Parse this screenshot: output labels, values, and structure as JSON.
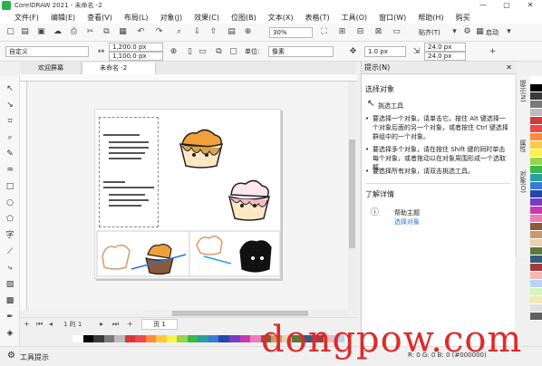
{
  "window": {
    "title": "CorelDRAW 2021 - 未命名 -2",
    "controls": [
      "—",
      "▢",
      "✕"
    ]
  },
  "menus": [
    "文件(F)",
    "编辑(E)",
    "查看(V)",
    "布局(L)",
    "对象(J)",
    "效果(C)",
    "位图(B)",
    "文本(X)",
    "表格(T)",
    "工具(O)",
    "窗口(W)",
    "帮助(H)",
    "购买"
  ],
  "toolbar": {
    "zoom": "30%",
    "snap": "贴齐(T)",
    "launch": "启动"
  },
  "propbar": {
    "preset": "自定义",
    "width": "1,200.0 px",
    "height": "1,100.0 px",
    "units_label": "单位:",
    "units": "像素",
    "nudge": "1.0 px",
    "dup_x": "24.0 px",
    "dup_y": "24.0 px"
  },
  "tabs": [
    {
      "label": "欢迎屏幕"
    },
    {
      "label": "未命名 -2"
    }
  ],
  "pagebar": {
    "page_count": "1 的 1",
    "page_tab": "页 1"
  },
  "docker": {
    "title": "提示(N)",
    "heading": "选择对象",
    "tool": "挑选工具",
    "tips": [
      "要选择一个对象，请单击它。按住 Alt 键选择一个对象后面的另一个对象，或者按住 Ctrl 键选择群组中的一个对象。",
      "要选择多个对象，请在按住 Shift 键的同时单击每个对象，或者拖动以在对象周围形成一个选取框。",
      "要选择所有对象，请双击挑选工具。"
    ],
    "more_heading": "了解详情",
    "help_title": "帮助主题",
    "help_link": "选择对象"
  },
  "side_tabs": [
    "提示(N)",
    "属性",
    "对象(O)"
  ],
  "status": {
    "left": "工具提示",
    "values": "R: 0 G: 0 B: 0 (#000000)"
  },
  "palette": [
    "#ffffff",
    "#000000",
    "#3a3a3a",
    "#7a7a7a",
    "#bcbcbc",
    "#d23a3a",
    "#f04848",
    "#ff8a3a",
    "#ffc840",
    "#fff04a",
    "#9ad44a",
    "#3ab84a",
    "#28a0a0",
    "#3a7ad4",
    "#2448a8",
    "#7a3ac8",
    "#c43ab0",
    "#f07ab8",
    "#8a5a3a",
    "#c89a6a",
    "#e8d2b0",
    "#5a7a3a",
    "#3a5a7a",
    "#a83a3a",
    "#f4b8b8",
    "#b8d4f4",
    "#d4f4b8",
    "#f4e8b8",
    "#e0e0e0",
    "#606060"
  ],
  "watermark": "dongpow.com"
}
